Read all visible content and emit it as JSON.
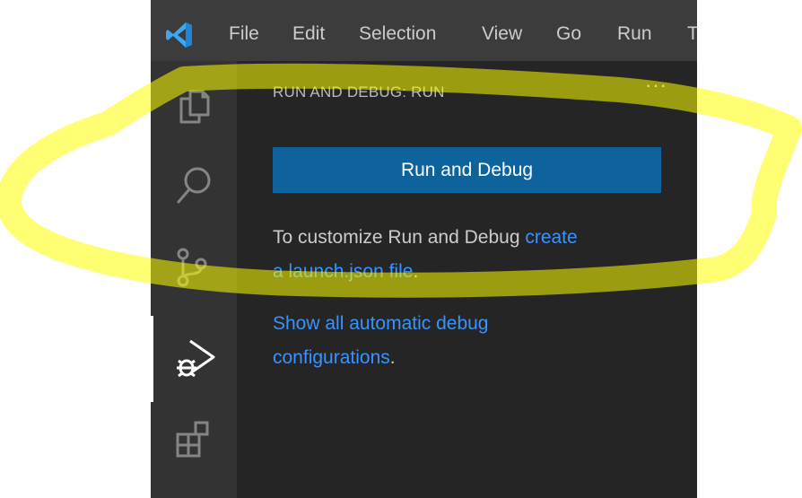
{
  "titlebar": {
    "menu": [
      "File",
      "Edit",
      "Selection",
      "View",
      "Go",
      "Run",
      "Terminal"
    ]
  },
  "activity_bar": {
    "items": [
      {
        "icon": "files-icon"
      },
      {
        "icon": "search-icon"
      },
      {
        "icon": "source-control-icon"
      },
      {
        "icon": "run-debug-icon",
        "active": true
      },
      {
        "icon": "extensions-icon"
      }
    ]
  },
  "sidebar": {
    "title": "RUN AND DEBUG: RUN",
    "more_label": "···",
    "run_button_label": "Run and Debug",
    "customize_text": "To customize Run and Debug ",
    "create_link_a": "create",
    "create_link_b": "a launch.json file",
    "period1": ".",
    "show_all_link_a": "Show all automatic debug",
    "show_all_link_b": "configurations",
    "period2": "."
  },
  "colors": {
    "accent_button": "#0e639c",
    "link": "#3794ff",
    "highlighter": "#ffff00"
  }
}
